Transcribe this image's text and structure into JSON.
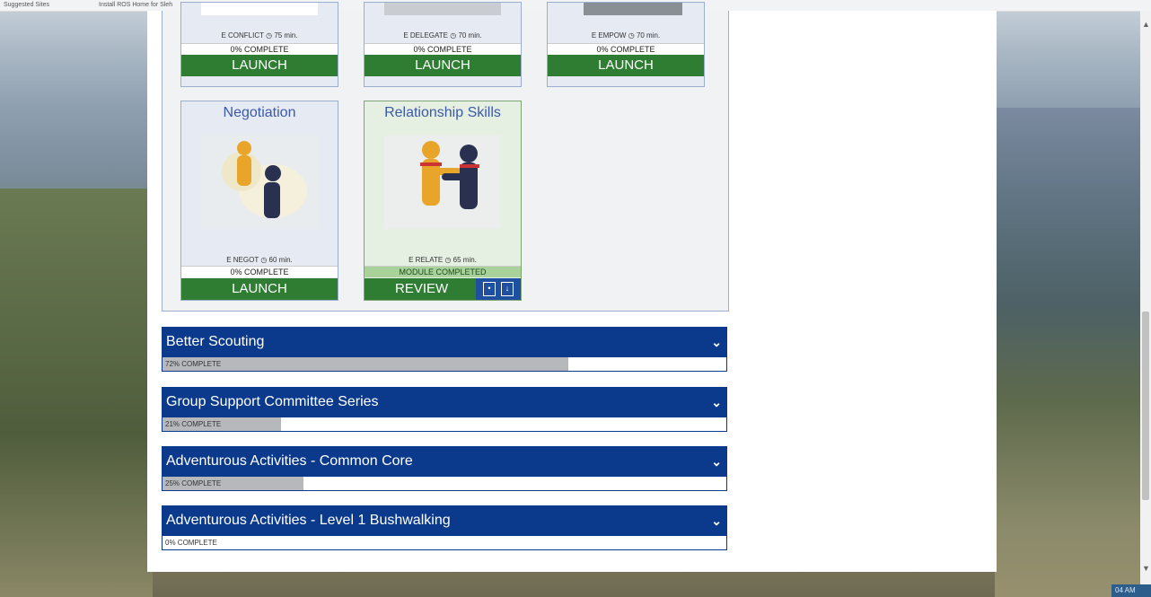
{
  "browser": {
    "bookmarks": [
      "Suggested Sites",
      "Install ROS Home for Sleh"
    ],
    "clock": "04 AM"
  },
  "modules": [
    {
      "title": "",
      "meta_code": "E CONFLICT",
      "duration": "75 min.",
      "progress": "0% COMPLETE",
      "action": "LAUNCH",
      "status": "incomplete"
    },
    {
      "title": "",
      "meta_code": "E DELEGATE",
      "duration": "70 min.",
      "progress": "0% COMPLETE",
      "action": "LAUNCH",
      "status": "incomplete"
    },
    {
      "title": "",
      "meta_code": "E EMPOW",
      "duration": "70 min.",
      "progress": "0% COMPLETE",
      "action": "LAUNCH",
      "status": "incomplete"
    },
    {
      "title": "Negotiation",
      "meta_code": "E NEGOT",
      "duration": "60 min.",
      "progress": "0% COMPLETE",
      "action": "LAUNCH",
      "status": "incomplete"
    },
    {
      "title": "Relationship Skills",
      "meta_code": "E RELATE",
      "duration": "65 min.",
      "progress": "MODULE COMPLETED",
      "action": "REVIEW",
      "status": "complete"
    }
  ],
  "courses": [
    {
      "title": "Better Scouting",
      "progress_label": "72% COMPLETE",
      "progress": 72
    },
    {
      "title": "Group Support Committee Series",
      "progress_label": "21% COMPLETE",
      "progress": 21
    },
    {
      "title": "Adventurous Activities - Common Core",
      "progress_label": "25% COMPLETE",
      "progress": 25
    },
    {
      "title": "Adventurous Activities - Level 1 Bushwalking",
      "progress_label": "0% COMPLETE",
      "progress": 0
    }
  ],
  "icons": {
    "clock": "clock-icon",
    "chevron": "chevron-down-icon",
    "pdf": "pdf-icon",
    "certificate": "certificate-icon"
  }
}
